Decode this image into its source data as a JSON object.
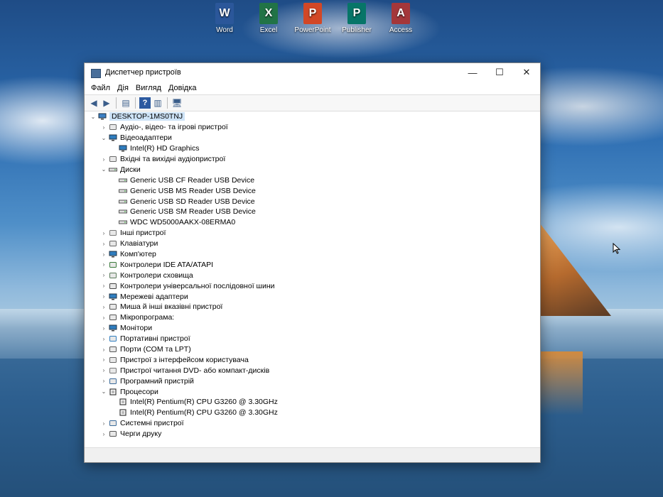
{
  "desktop": {
    "icons": [
      {
        "label": "Word",
        "letter": "W",
        "color": "#2b579a"
      },
      {
        "label": "Excel",
        "letter": "X",
        "color": "#217346"
      },
      {
        "label": "PowerPoint",
        "letter": "P",
        "color": "#d24726"
      },
      {
        "label": "Publisher",
        "letter": "P",
        "color": "#077568"
      },
      {
        "label": "Access",
        "letter": "A",
        "color": "#a4373a"
      }
    ]
  },
  "window": {
    "title": "Диспетчер пристроїв",
    "controls": {
      "minimize": "—",
      "maximize": "☐",
      "close": "✕"
    }
  },
  "menu": [
    "Файл",
    "Дія",
    "Вигляд",
    "Довідка"
  ],
  "tree": {
    "root": "DESKTOP-1MS0TNJ",
    "items": [
      {
        "label": "Аудіо-, відео- та ігрові пристрої",
        "level": 1,
        "expanded": false,
        "icon": "audio-icon"
      },
      {
        "label": "Відеоадаптери",
        "level": 1,
        "expanded": true,
        "icon": "display-adapter-icon"
      },
      {
        "label": "Intel(R) HD Graphics",
        "level": 2,
        "icon": "display-adapter-icon"
      },
      {
        "label": "Вхідні та вихідні аудіопристрої",
        "level": 1,
        "expanded": false,
        "icon": "audio-io-icon"
      },
      {
        "label": "Диски",
        "level": 1,
        "expanded": true,
        "icon": "disk-icon"
      },
      {
        "label": "Generic USB CF Reader USB Device",
        "level": 2,
        "icon": "disk-icon"
      },
      {
        "label": "Generic USB MS Reader USB Device",
        "level": 2,
        "icon": "disk-icon"
      },
      {
        "label": "Generic USB SD Reader USB Device",
        "level": 2,
        "icon": "disk-icon"
      },
      {
        "label": "Generic USB SM Reader USB Device",
        "level": 2,
        "icon": "disk-icon"
      },
      {
        "label": "WDC WD5000AAKX-08ERMA0",
        "level": 2,
        "icon": "disk-icon"
      },
      {
        "label": "Інші пристрої",
        "level": 1,
        "expanded": false,
        "icon": "other-devices-icon"
      },
      {
        "label": "Клавіатури",
        "level": 1,
        "expanded": false,
        "icon": "keyboard-icon"
      },
      {
        "label": "Комп'ютер",
        "level": 1,
        "expanded": false,
        "icon": "computer-icon"
      },
      {
        "label": "Контролери IDE ATA/ATAPI",
        "level": 1,
        "expanded": false,
        "icon": "ide-icon"
      },
      {
        "label": "Контролери сховища",
        "level": 1,
        "expanded": false,
        "icon": "storage-icon"
      },
      {
        "label": "Контролери універсальної послідовної шини",
        "level": 1,
        "expanded": false,
        "icon": "usb-icon"
      },
      {
        "label": "Мережеві адаптери",
        "level": 1,
        "expanded": false,
        "icon": "network-icon"
      },
      {
        "label": "Миша й інші вказівні пристрої",
        "level": 1,
        "expanded": false,
        "icon": "mouse-icon"
      },
      {
        "label": "Мікропрограма:",
        "level": 1,
        "expanded": false,
        "icon": "firmware-icon"
      },
      {
        "label": "Монітори",
        "level": 1,
        "expanded": false,
        "icon": "monitor-icon"
      },
      {
        "label": "Портативні пристрої",
        "level": 1,
        "expanded": false,
        "icon": "portable-icon"
      },
      {
        "label": "Порти (COM та LPT)",
        "level": 1,
        "expanded": false,
        "icon": "port-icon"
      },
      {
        "label": "Пристрої з інтерфейсом користувача",
        "level": 1,
        "expanded": false,
        "icon": "hid-icon"
      },
      {
        "label": "Пристрої читання DVD- або компакт-дисків",
        "level": 1,
        "expanded": false,
        "icon": "dvd-icon"
      },
      {
        "label": "Програмний пристрій",
        "level": 1,
        "expanded": false,
        "icon": "software-device-icon"
      },
      {
        "label": "Процесори",
        "level": 1,
        "expanded": true,
        "icon": "processor-icon"
      },
      {
        "label": "Intel(R) Pentium(R) CPU G3260 @ 3.30GHz",
        "level": 2,
        "icon": "processor-icon"
      },
      {
        "label": "Intel(R) Pentium(R) CPU G3260 @ 3.30GHz",
        "level": 2,
        "icon": "processor-icon"
      },
      {
        "label": "Системні пристрої",
        "level": 1,
        "expanded": false,
        "icon": "system-devices-icon"
      },
      {
        "label": "Черги друку",
        "level": 1,
        "expanded": false,
        "icon": "print-queue-icon"
      }
    ]
  }
}
